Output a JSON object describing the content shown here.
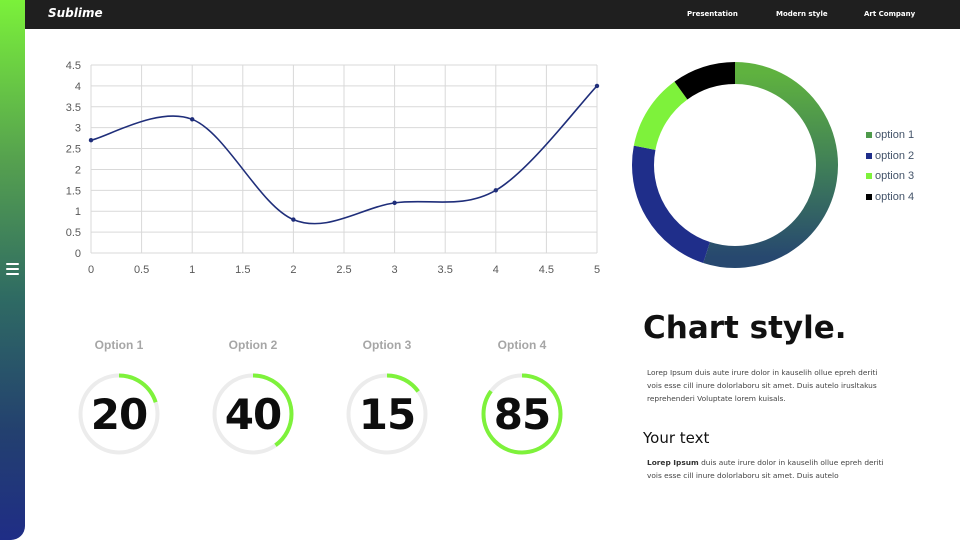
{
  "header": {
    "brand": "Sublime",
    "nav": [
      "Presentation",
      "Modern style",
      "Art Company"
    ]
  },
  "sidebar": {
    "menu_icon": "hamburger-menu-icon"
  },
  "line_chart": {
    "type": "line",
    "x": [
      0,
      1,
      2,
      3,
      4,
      5
    ],
    "y": [
      2.7,
      3.2,
      0.8,
      1.2,
      1.5,
      4.0
    ],
    "xlim": [
      0,
      5
    ],
    "ylim": [
      0,
      4.5
    ],
    "x_ticks": [
      "0",
      "0.5",
      "1",
      "1.5",
      "2",
      "2.5",
      "3",
      "3.5",
      "4",
      "4.5",
      "5"
    ],
    "y_ticks": [
      "0",
      "0.5",
      "1",
      "1.5",
      "2",
      "2.5",
      "3",
      "3.5",
      "4",
      "4.5"
    ],
    "grid": true,
    "line_color": "#1f2e7a",
    "smooth": true
  },
  "donut_chart": {
    "type": "pie",
    "labels": [
      "option 1",
      "option 2",
      "option 3",
      "option 4"
    ],
    "values": [
      55,
      23,
      12,
      10
    ],
    "colors": [
      "#4e9a4b",
      "#1f2e8a",
      "#7ef23b",
      "#000000"
    ],
    "legend_position": "right"
  },
  "chart_data": [
    {
      "type": "line",
      "x": [
        0,
        1,
        2,
        3,
        4,
        5
      ],
      "y": [
        2.7,
        3.2,
        0.8,
        1.2,
        1.5,
        4.0
      ],
      "xlim": [
        0,
        5
      ],
      "ylim": [
        0,
        4.5
      ],
      "grid": true
    },
    {
      "type": "pie",
      "categories": [
        "option 1",
        "option 2",
        "option 3",
        "option 4"
      ],
      "values": [
        55,
        23,
        12,
        10
      ],
      "legend": "right"
    }
  ],
  "gauges": [
    {
      "label": "Option 1",
      "value": "20",
      "percent": 20
    },
    {
      "label": "Option 2",
      "value": "40",
      "percent": 40
    },
    {
      "label": "Option 3",
      "value": "15",
      "percent": 15
    },
    {
      "label": "Option 4",
      "value": "85",
      "percent": 85
    }
  ],
  "gauge_colors": {
    "track": "#ececec",
    "fill": "#7ef23b"
  },
  "content": {
    "title": "Chart style.",
    "paragraph1": "Lorep  Ipsum duis aute irure dolor in kauselih ollue epreh deriti vois esse cill inure dolorlaboru sit amet. Duis autelo irusltakus reprehenderi Voluptate lorem kuisals.",
    "subtitle": "Your text",
    "paragraph2_bold": "Lorep  Ipsum",
    "paragraph2_rest": " duis aute irure dolor in kauselih ollue epreh deriti vois esse cill inure dolorlaboru sit amet. Duis autelo"
  }
}
